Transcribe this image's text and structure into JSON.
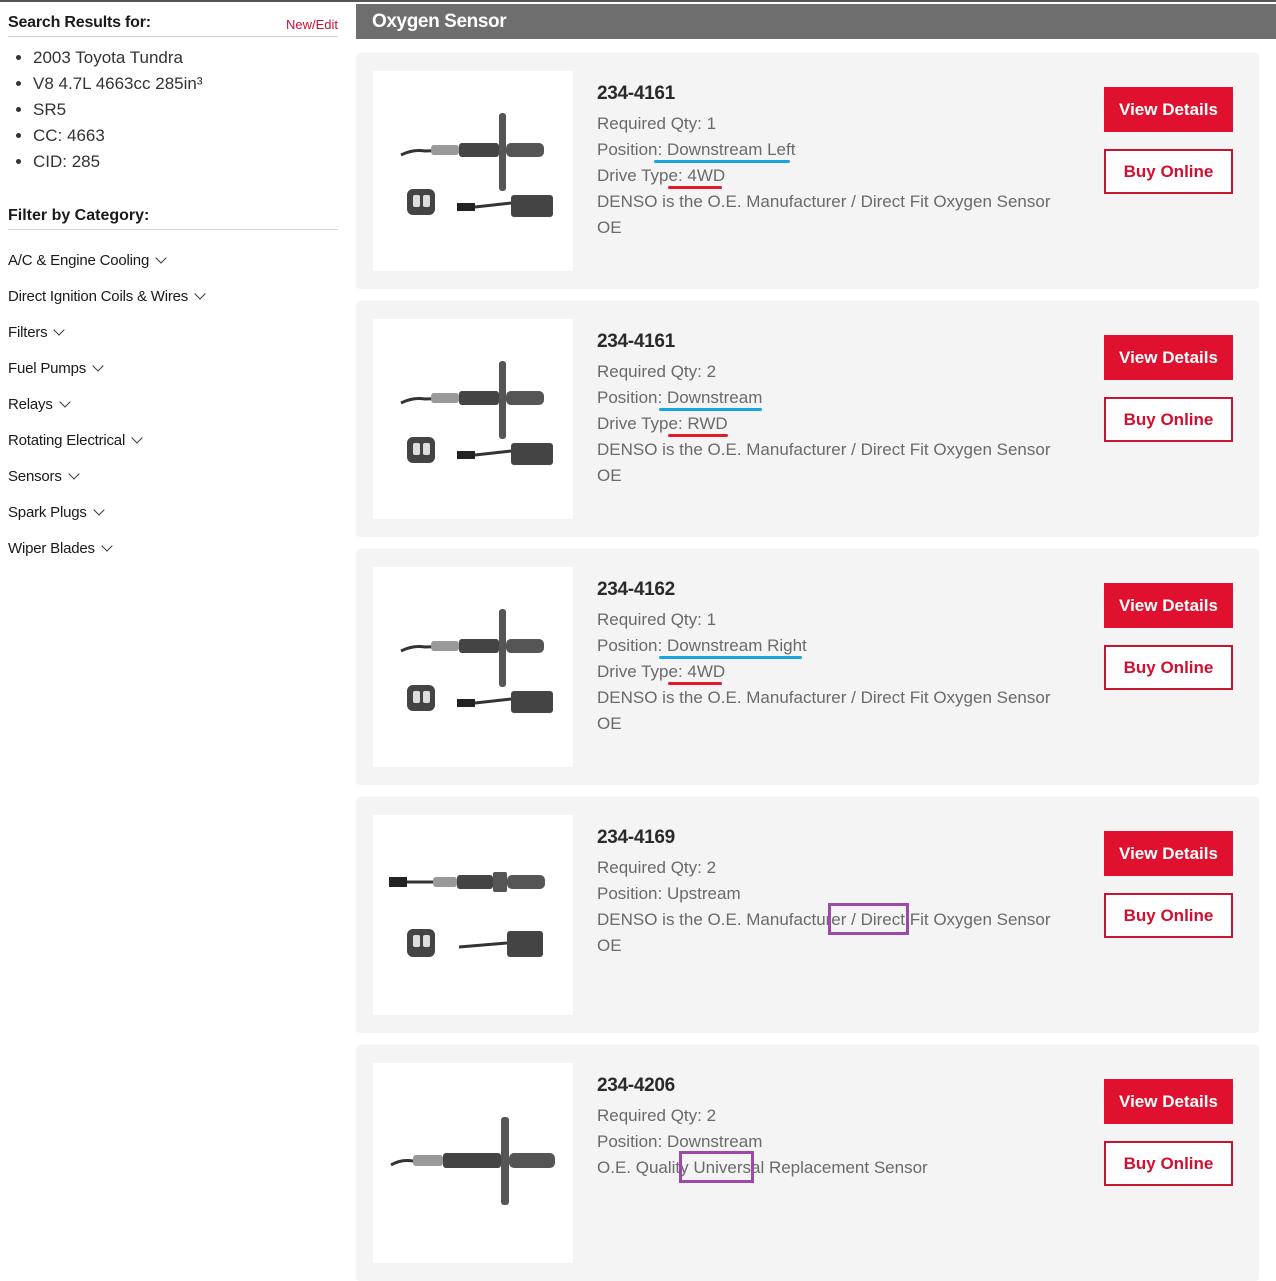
{
  "sidebar": {
    "title": "Search Results for:",
    "edit_link": "New/Edit",
    "vehicle": [
      "2003 Toyota Tundra",
      "V8 4.7L 4663cc 285in³",
      "SR5",
      "CC: 4663",
      "CID: 285"
    ],
    "filter_title": "Filter by Category:",
    "categories": [
      "A/C & Engine Cooling",
      "Direct Ignition Coils & Wires",
      "Filters",
      "Fuel Pumps",
      "Relays",
      "Rotating Electrical",
      "Sensors",
      "Spark Plugs",
      "Wiper Blades"
    ]
  },
  "main": {
    "section_title": "Oxygen Sensor",
    "view_label": "View Details",
    "buy_label": "Buy Online",
    "qty_prefix": "Required Qty: ",
    "position_prefix": "Position: ",
    "drive_prefix": "Drive Type: ",
    "products": [
      {
        "part": "234-4161",
        "qty": "1",
        "position": "Downstream Left",
        "drive": "4WD",
        "desc": "DENSO is the O.E. Manufacturer / Direct Fit Oxygen Sensor",
        "oe": "OE"
      },
      {
        "part": "234-4161",
        "qty": "2",
        "position": "Downstream",
        "drive": "RWD",
        "desc": "DENSO is the O.E. Manufacturer / Direct Fit Oxygen Sensor",
        "oe": "OE"
      },
      {
        "part": "234-4162",
        "qty": "1",
        "position": "Downstream Right",
        "drive": "4WD",
        "desc": "DENSO is the O.E. Manufacturer / Direct Fit Oxygen Sensor",
        "oe": "OE"
      },
      {
        "part": "234-4169",
        "qty": "2",
        "position": "Upstream",
        "desc": "DENSO is the O.E. Manufacturer / Direct Fit Oxygen Sensor",
        "oe": "OE"
      },
      {
        "part": "234-4206",
        "qty": "2",
        "position": "Downstream",
        "desc": "O.E. Quality Universal Replacement Sensor"
      }
    ]
  },
  "colors": {
    "accent_red": "#e0102f",
    "header_gray": "#6e6e6e",
    "card_bg": "#f4f4f4",
    "annotation_blue": "#1aa3e0",
    "annotation_red": "#e41b2b",
    "annotation_purple": "#9b4aa8"
  }
}
